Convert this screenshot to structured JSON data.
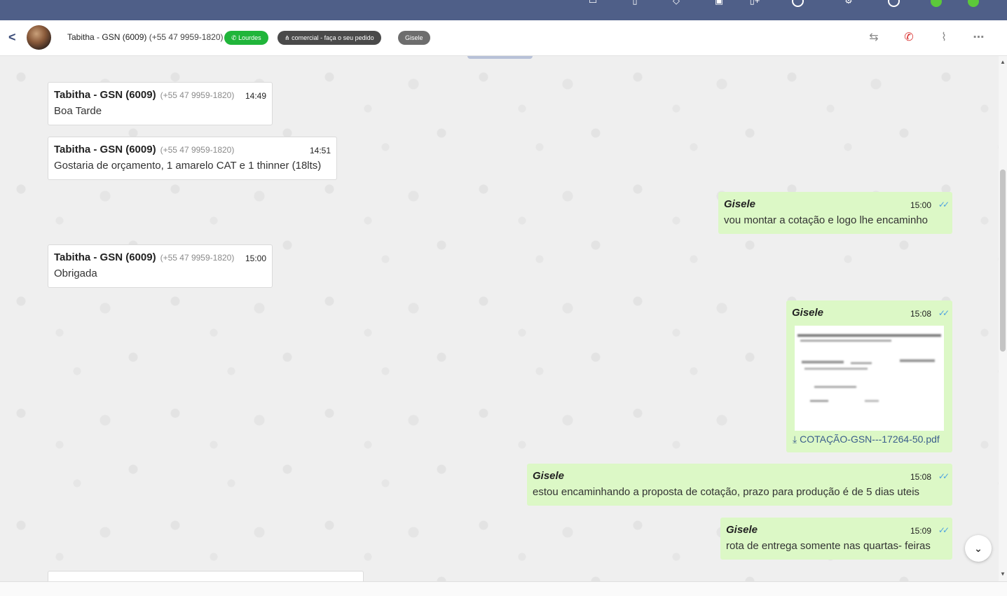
{
  "header": {
    "back_icon": "chevron-left-icon",
    "contact_name": "Tabitha - GSN (6009)",
    "contact_phone": "(+55 47 9959-1820)",
    "tags": [
      {
        "label": "Lourdes",
        "icon": "whatsapp-icon",
        "color": "#20b53a"
      },
      {
        "label": "comercial - faça o seu pedido",
        "icon": "sitemap-icon",
        "color": "#4a4a4a"
      },
      {
        "label": "Gisele",
        "color": "#6d6d6d"
      }
    ],
    "actions": [
      "transfer-icon",
      "end-call-icon",
      "attach-icon",
      "more-icon"
    ]
  },
  "messages": [
    {
      "dir": "in",
      "name": "Tabitha - GSN (6009)",
      "phone": "(+55 47 9959-1820)",
      "time": "14:49",
      "text": "Boa Tarde"
    },
    {
      "dir": "in",
      "name": "Tabitha - GSN (6009)",
      "phone": "(+55 47 9959-1820)",
      "time": "14:51",
      "text": "Gostaria de orçamento, 1 amarelo CAT e 1 thinner (18lts)"
    },
    {
      "dir": "out",
      "name": "Gisele",
      "time": "15:00",
      "text": "vou montar a cotação e logo lhe encaminho"
    },
    {
      "dir": "in",
      "name": "Tabitha - GSN (6009)",
      "phone": "(+55 47 9959-1820)",
      "time": "15:00",
      "text": "Obrigada"
    },
    {
      "dir": "out",
      "name": "Gisele",
      "time": "15:08",
      "attachment": "COTAÇÃO-GSN---17264-50.pdf"
    },
    {
      "dir": "out",
      "name": "Gisele",
      "time": "15:08",
      "text": "estou encaminhando a proposta de cotação, prazo para produção é de 5 dias uteis"
    },
    {
      "dir": "out",
      "name": "Gisele",
      "time": "15:09",
      "text": "rota de entrega somente nas quartas- feiras"
    }
  ],
  "colors": {
    "topbar": "#4f5f88",
    "incoming": "#ffffff",
    "outgoing": "#dcf8c6",
    "read_ticks": "#4fa3e0"
  }
}
